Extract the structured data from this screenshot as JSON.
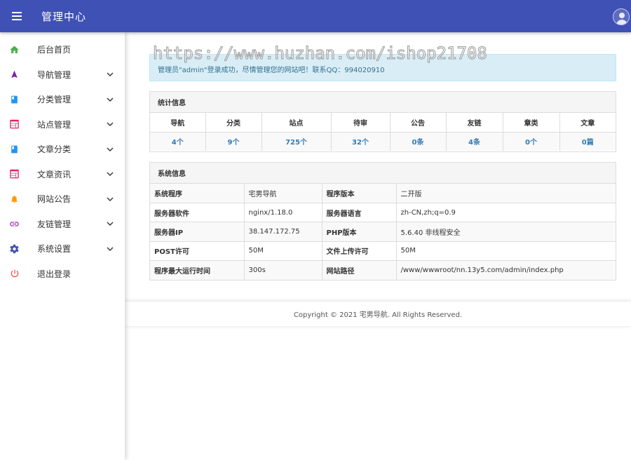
{
  "header": {
    "title": "管理中心"
  },
  "watermark": "https://www.huzhan.com/ishop21708",
  "sidebar": {
    "items": [
      {
        "label": "后台首页",
        "icon": "home-icon",
        "color": "#4caf50",
        "has_children": false
      },
      {
        "label": "导航管理",
        "icon": "navigation-icon",
        "color": "#7b1fa2",
        "has_children": true
      },
      {
        "label": "分类管理",
        "icon": "book-icon",
        "color": "#2196f3",
        "has_children": true
      },
      {
        "label": "站点管理",
        "icon": "web-icon",
        "color": "#e91e63",
        "has_children": true
      },
      {
        "label": "文章分类",
        "icon": "book-icon",
        "color": "#2196f3",
        "has_children": true
      },
      {
        "label": "文章资讯",
        "icon": "web-icon",
        "color": "#e91e63",
        "has_children": true
      },
      {
        "label": "网站公告",
        "icon": "bell-icon",
        "color": "#ff9800",
        "has_children": true
      },
      {
        "label": "友链管理",
        "icon": "link-icon",
        "color": "#9c27b0",
        "has_children": true
      },
      {
        "label": "系统设置",
        "icon": "gear-icon",
        "color": "#3f51b5",
        "has_children": true
      },
      {
        "label": "退出登录",
        "icon": "power-icon",
        "color": "#f44336",
        "has_children": false
      }
    ]
  },
  "alert": {
    "text": "管理员\"admin\"登录成功，尽情管理您的网站吧！联系QQ：994020910"
  },
  "stats": {
    "title": "统计信息",
    "headers": [
      "导航",
      "分类",
      "站点",
      "待审",
      "公告",
      "友链",
      "章类",
      "文章"
    ],
    "values": [
      "4个",
      "9个",
      "725个",
      "32个",
      "0条",
      "4条",
      "0个",
      "0篇"
    ]
  },
  "system": {
    "title": "系统信息",
    "rows": [
      [
        "系统程序",
        "宅男导航",
        "程序版本",
        "二开版"
      ],
      [
        "服务器软件",
        "nginx/1.18.0",
        "服务器语言",
        "zh-CN,zh;q=0.9"
      ],
      [
        "服务器IP",
        "38.147.172.75",
        "PHP版本",
        "5.6.40 非线程安全"
      ],
      [
        "POST许可",
        "50M",
        "文件上传许可",
        "50M"
      ],
      [
        "程序最大运行时间",
        "300s",
        "网站路径",
        "/www/wwwroot/nn.13y5.com/admin/index.php"
      ]
    ]
  },
  "footer": {
    "text": "Copyright © 2021 宅男导航. All Rights Reserved."
  },
  "colors": {
    "topbar": "#3f51b5",
    "alert_bg": "#d9edf7",
    "link": "#337ab7"
  }
}
